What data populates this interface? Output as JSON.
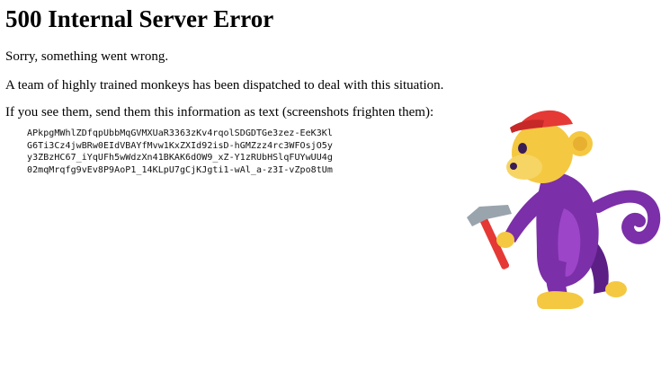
{
  "page": {
    "title": "500 Internal Server Error",
    "message_1": "Sorry, something went wrong.",
    "message_2": "A team of highly trained monkeys has been dispatched to deal with this situation.",
    "message_3": "If you see them, send them this information as text (screenshots frighten them):",
    "error_code_lines": [
      "APkpgMWhlZDfqpUbbMqGVMXUaR3363zKv4rqolSDGDTGe3zez-EeK3Kl",
      "G6Ti3Cz4jwBRw0EIdVBAYfMvw1KxZXId92isD-hGMZzz4rc3WFOsjO5y",
      "y3ZBzHC67_iYqUFh5wWdzXn41BKAK6dOW9_xZ-Y1zRUbHSlqFUYwUU4g",
      "02mqMrqfg9vEv8P9AoP1_14KLpU7gCjKJgti1-wAl_a-z3I-vZpo8tUm"
    ]
  },
  "illustration": {
    "name": "monkey-with-hammer",
    "colors": {
      "fur": "#7b2fa8",
      "fur_dark": "#5b1f86",
      "face": "#f5c842",
      "hat": "#e53935",
      "hammer_head": "#9aa4ad",
      "hammer_handle": "#e53935"
    }
  }
}
